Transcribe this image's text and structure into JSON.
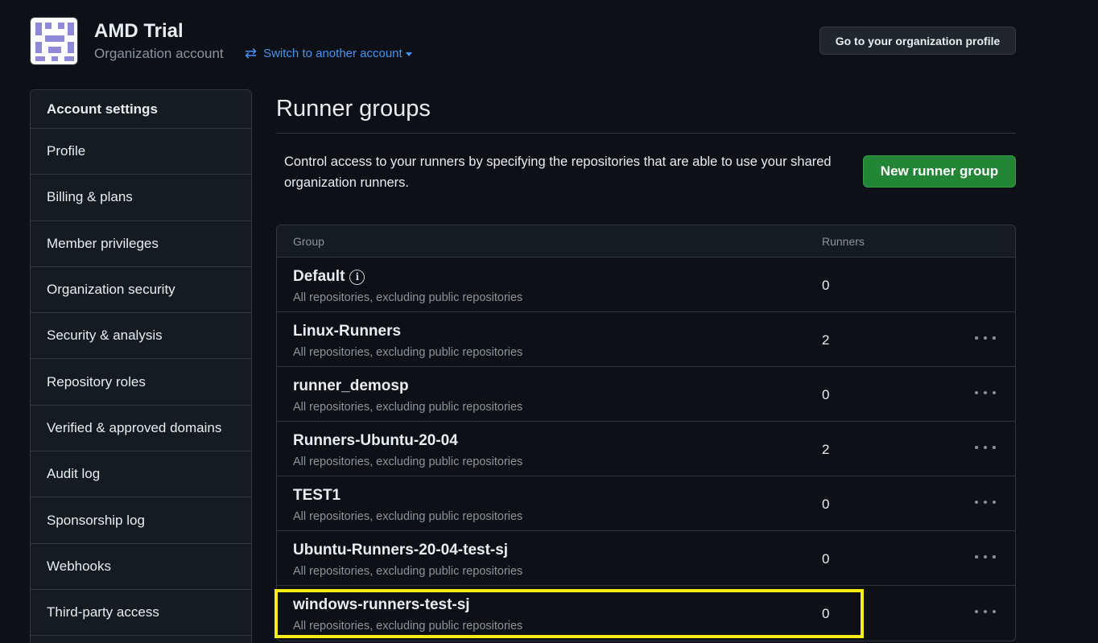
{
  "header": {
    "org_name": "AMD Trial",
    "org_type": "Organization account",
    "switch_icon": "arrows-switch-icon",
    "switch_label": "Switch to another account",
    "profile_button": "Go to your organization profile"
  },
  "sidebar": {
    "heading": "Account settings",
    "items": [
      {
        "label": "Profile"
      },
      {
        "label": "Billing & plans"
      },
      {
        "label": "Member privileges"
      },
      {
        "label": "Organization security"
      },
      {
        "label": "Security & analysis"
      },
      {
        "label": "Repository roles"
      },
      {
        "label": "Verified & approved domains"
      },
      {
        "label": "Audit log"
      },
      {
        "label": "Sponsorship log"
      },
      {
        "label": "Webhooks"
      },
      {
        "label": "Third-party access"
      }
    ]
  },
  "main": {
    "title": "Runner groups",
    "intro": "Control access to your runners by specifying the repositories that are able to use your shared organization runners.",
    "new_button": "New runner group",
    "table": {
      "col_group": "Group",
      "col_runners": "Runners",
      "rows": [
        {
          "name": "Default",
          "sub": "All repositories, excluding public repositories",
          "runners": "0",
          "info": "i"
        },
        {
          "name": "Linux-Runners",
          "sub": "All repositories, excluding public repositories",
          "runners": "2"
        },
        {
          "name": "runner_demosp",
          "sub": "All repositories, excluding public repositories",
          "runners": "0"
        },
        {
          "name": "Runners-Ubuntu-20-04",
          "sub": "All repositories, excluding public repositories",
          "runners": "2"
        },
        {
          "name": "TEST1",
          "sub": "All repositories, excluding public repositories",
          "runners": "0"
        },
        {
          "name": "Ubuntu-Runners-20-04-test-sj",
          "sub": "All repositories, excluding public repositories",
          "runners": "0"
        },
        {
          "name": "windows-runners-test-sj",
          "sub": "All repositories, excluding public repositories",
          "runners": "0"
        }
      ]
    }
  },
  "colors": {
    "background": "#0d1117",
    "accent_link": "#4493f8",
    "primary_button": "#238636",
    "highlight": "#f7ec13"
  }
}
